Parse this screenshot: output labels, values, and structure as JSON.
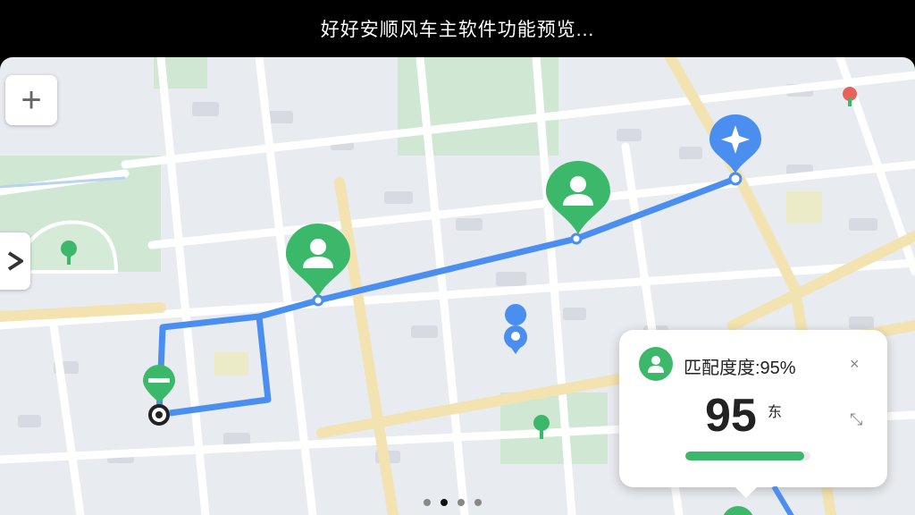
{
  "header": {
    "title": "好好安顺风车主软件功能预览..."
  },
  "map": {
    "zoom_in_label": "+",
    "route_color": "#4a8ff0",
    "passenger_pin_color": "#3cb86b",
    "destination_pin_color": "#4a8ff0"
  },
  "match_card": {
    "title": "匹配度度:95%",
    "score": "95",
    "unit": "东",
    "close_label": "×",
    "expand_label": "⤡",
    "progress_percent": 95
  },
  "pager": {
    "count": 4,
    "active_index": 1
  }
}
